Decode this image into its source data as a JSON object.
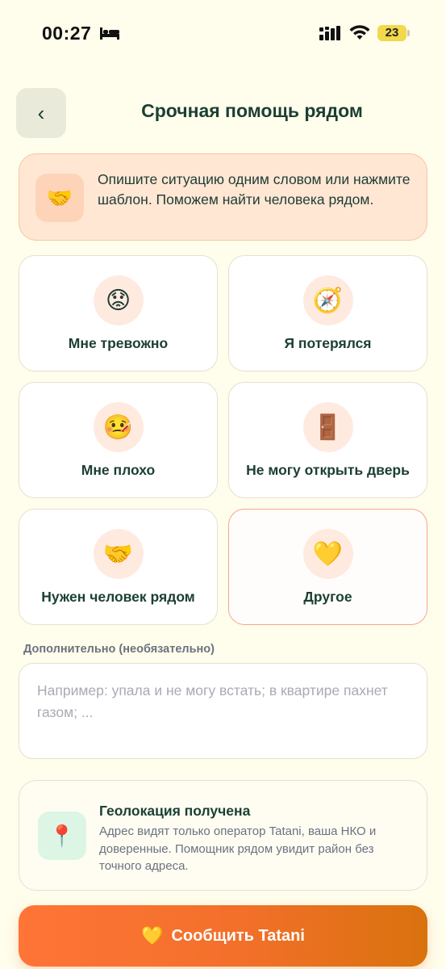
{
  "status_bar": {
    "time": "00:27",
    "battery": "23",
    "icons": [
      "bed-icon",
      "signal-icon",
      "wifi-icon",
      "battery-icon"
    ]
  },
  "header": {
    "back_label": "‹",
    "title": "Срочная помощь рядом"
  },
  "intro": {
    "icon": "🤝",
    "text": "Опишите ситуацию одним словом или нажмите шаблон. Поможем найти человека рядом."
  },
  "templates": [
    {
      "icon": "😟",
      "label": "Мне тревожно",
      "selected": false
    },
    {
      "icon": "🧭",
      "label": "Я потерялся",
      "selected": false
    },
    {
      "icon": "🤒",
      "label": "Мне плохо",
      "selected": false
    },
    {
      "icon": "🚪",
      "label": "Не могу открыть дверь",
      "selected": false
    },
    {
      "icon": "🤝",
      "label": "Нужен человек рядом",
      "selected": false
    },
    {
      "icon": "💛",
      "label": "Другое",
      "selected": true
    }
  ],
  "details": {
    "label": "Дополнительно (необязательно)",
    "placeholder": "Например: упала и не могу встать; в квартире пахнет газом; ...",
    "value": ""
  },
  "geo": {
    "icon": "📍",
    "title": "Геолокация получена",
    "description": "Адрес видят только оператор Tatani, ваша НКО и доверенные. Помощник рядом увидит район без точного адреса."
  },
  "submit": {
    "icon": "💛",
    "label": "Сообщить Tatani"
  },
  "colors": {
    "background": "#FFFDEB",
    "primary_text": "#1B3F33",
    "accent": "#FF7437",
    "accent_end": "#D9720E",
    "selected_border": "#F4A98A"
  }
}
